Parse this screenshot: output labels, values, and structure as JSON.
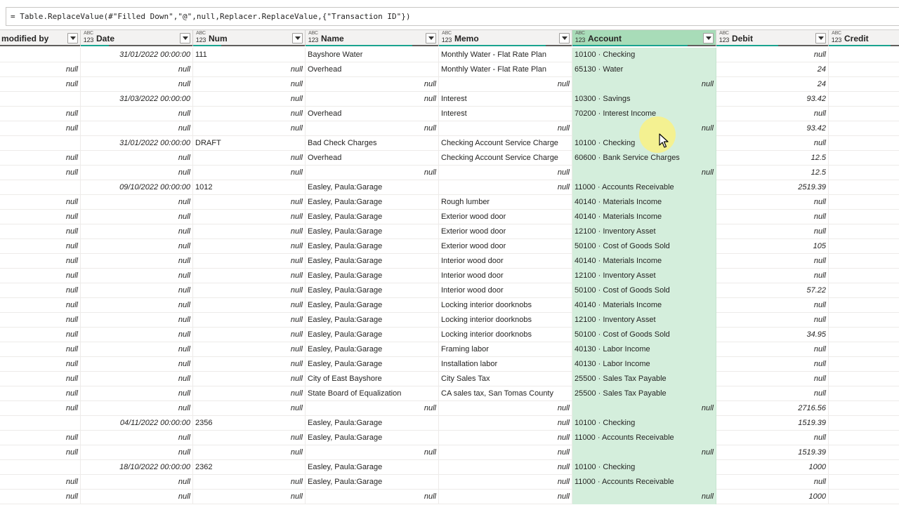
{
  "formula": {
    "text": "= Table.ReplaceValue(#\"Filled Down\",\"@\",null,Replacer.ReplaceValue,{\"Transaction ID\"})"
  },
  "columns": [
    {
      "key": "modified_by",
      "title": "modified by",
      "icon": false
    },
    {
      "key": "date",
      "title": "Date",
      "icon": true
    },
    {
      "key": "num",
      "title": "Num",
      "icon": true
    },
    {
      "key": "name",
      "title": "Name",
      "icon": true
    },
    {
      "key": "memo",
      "title": "Memo",
      "icon": true
    },
    {
      "key": "account",
      "title": "Account",
      "icon": true,
      "selected": true
    },
    {
      "key": "debit",
      "title": "Debit",
      "icon": true
    },
    {
      "key": "credit",
      "title": "Credit",
      "icon": true
    }
  ],
  "type_icon": {
    "top": "ABC",
    "bottom": "123"
  },
  "colors": {
    "selected_header": "#a8dcb8",
    "selected_cells": "#d4eedc",
    "quality_valid": "#1aa38f",
    "quality_empty": "#605e5c"
  },
  "rows": [
    [
      "",
      "31/01/2022 00:00:00",
      "111",
      "Bayshore Water",
      "Monthly Water - Flat Rate Plan",
      "10100 · Checking",
      "null"
    ],
    [
      "null",
      "null",
      "null",
      "Overhead",
      "Monthly Water - Flat Rate Plan",
      "65130 · Water",
      "24"
    ],
    [
      "null",
      "null",
      "null",
      "null",
      "null",
      "null",
      "24"
    ],
    [
      "",
      "31/03/2022 00:00:00",
      "null",
      "null",
      "Interest",
      "10300 · Savings",
      "93.42"
    ],
    [
      "null",
      "null",
      "null",
      "Overhead",
      "Interest",
      "70200 · Interest Income",
      "null"
    ],
    [
      "null",
      "null",
      "null",
      "null",
      "null",
      "null",
      "93.42"
    ],
    [
      "",
      "31/01/2022 00:00:00",
      "DRAFT",
      "Bad Check Charges",
      "Checking Account Service Charge",
      "10100 · Checking",
      "null"
    ],
    [
      "null",
      "null",
      "null",
      "Overhead",
      "Checking Account Service Charge",
      "60600 · Bank Service Charges",
      "12.5"
    ],
    [
      "null",
      "null",
      "null",
      "null",
      "null",
      "null",
      "12.5"
    ],
    [
      "",
      "09/10/2022 00:00:00",
      "1012",
      "Easley, Paula:Garage",
      "null",
      "11000 · Accounts Receivable",
      "2519.39"
    ],
    [
      "null",
      "null",
      "null",
      "Easley, Paula:Garage",
      "Rough lumber",
      "40140 · Materials Income",
      "null"
    ],
    [
      "null",
      "null",
      "null",
      "Easley, Paula:Garage",
      "Exterior wood door",
      "40140 · Materials Income",
      "null"
    ],
    [
      "null",
      "null",
      "null",
      "Easley, Paula:Garage",
      "Exterior wood door",
      "12100 · Inventory Asset",
      "null"
    ],
    [
      "null",
      "null",
      "null",
      "Easley, Paula:Garage",
      "Exterior wood door",
      "50100 · Cost of Goods Sold",
      "105"
    ],
    [
      "null",
      "null",
      "null",
      "Easley, Paula:Garage",
      "Interior wood door",
      "40140 · Materials Income",
      "null"
    ],
    [
      "null",
      "null",
      "null",
      "Easley, Paula:Garage",
      "Interior wood door",
      "12100 · Inventory Asset",
      "null"
    ],
    [
      "null",
      "null",
      "null",
      "Easley, Paula:Garage",
      "Interior wood door",
      "50100 · Cost of Goods Sold",
      "57.22"
    ],
    [
      "null",
      "null",
      "null",
      "Easley, Paula:Garage",
      "Locking interior doorknobs",
      "40140 · Materials Income",
      "null"
    ],
    [
      "null",
      "null",
      "null",
      "Easley, Paula:Garage",
      "Locking interior doorknobs",
      "12100 · Inventory Asset",
      "null"
    ],
    [
      "null",
      "null",
      "null",
      "Easley, Paula:Garage",
      "Locking interior doorknobs",
      "50100 · Cost of Goods Sold",
      "34.95"
    ],
    [
      "null",
      "null",
      "null",
      "Easley, Paula:Garage",
      "Framing labor",
      "40130 · Labor Income",
      "null"
    ],
    [
      "null",
      "null",
      "null",
      "Easley, Paula:Garage",
      "Installation labor",
      "40130 · Labor Income",
      "null"
    ],
    [
      "null",
      "null",
      "null",
      "City of East Bayshore",
      "City Sales Tax",
      "25500 · Sales Tax Payable",
      "null"
    ],
    [
      "null",
      "null",
      "null",
      "State Board of Equalization",
      "CA sales tax, San Tomas County",
      "25500 · Sales Tax Payable",
      "null"
    ],
    [
      "null",
      "null",
      "null",
      "null",
      "null",
      "null",
      "2716.56"
    ],
    [
      "",
      "04/11/2022 00:00:00",
      "2356",
      "Easley, Paula:Garage",
      "null",
      "10100 · Checking",
      "1519.39"
    ],
    [
      "null",
      "null",
      "null",
      "Easley, Paula:Garage",
      "null",
      "11000 · Accounts Receivable",
      "null"
    ],
    [
      "null",
      "null",
      "null",
      "null",
      "null",
      "null",
      "1519.39"
    ],
    [
      "",
      "18/10/2022 00:00:00",
      "2362",
      "Easley, Paula:Garage",
      "null",
      "10100 · Checking",
      "1000"
    ],
    [
      "null",
      "null",
      "null",
      "Easley, Paula:Garage",
      "null",
      "11000 · Accounts Receivable",
      "null"
    ],
    [
      "null",
      "null",
      "null",
      "null",
      "null",
      "null",
      "1000"
    ]
  ]
}
